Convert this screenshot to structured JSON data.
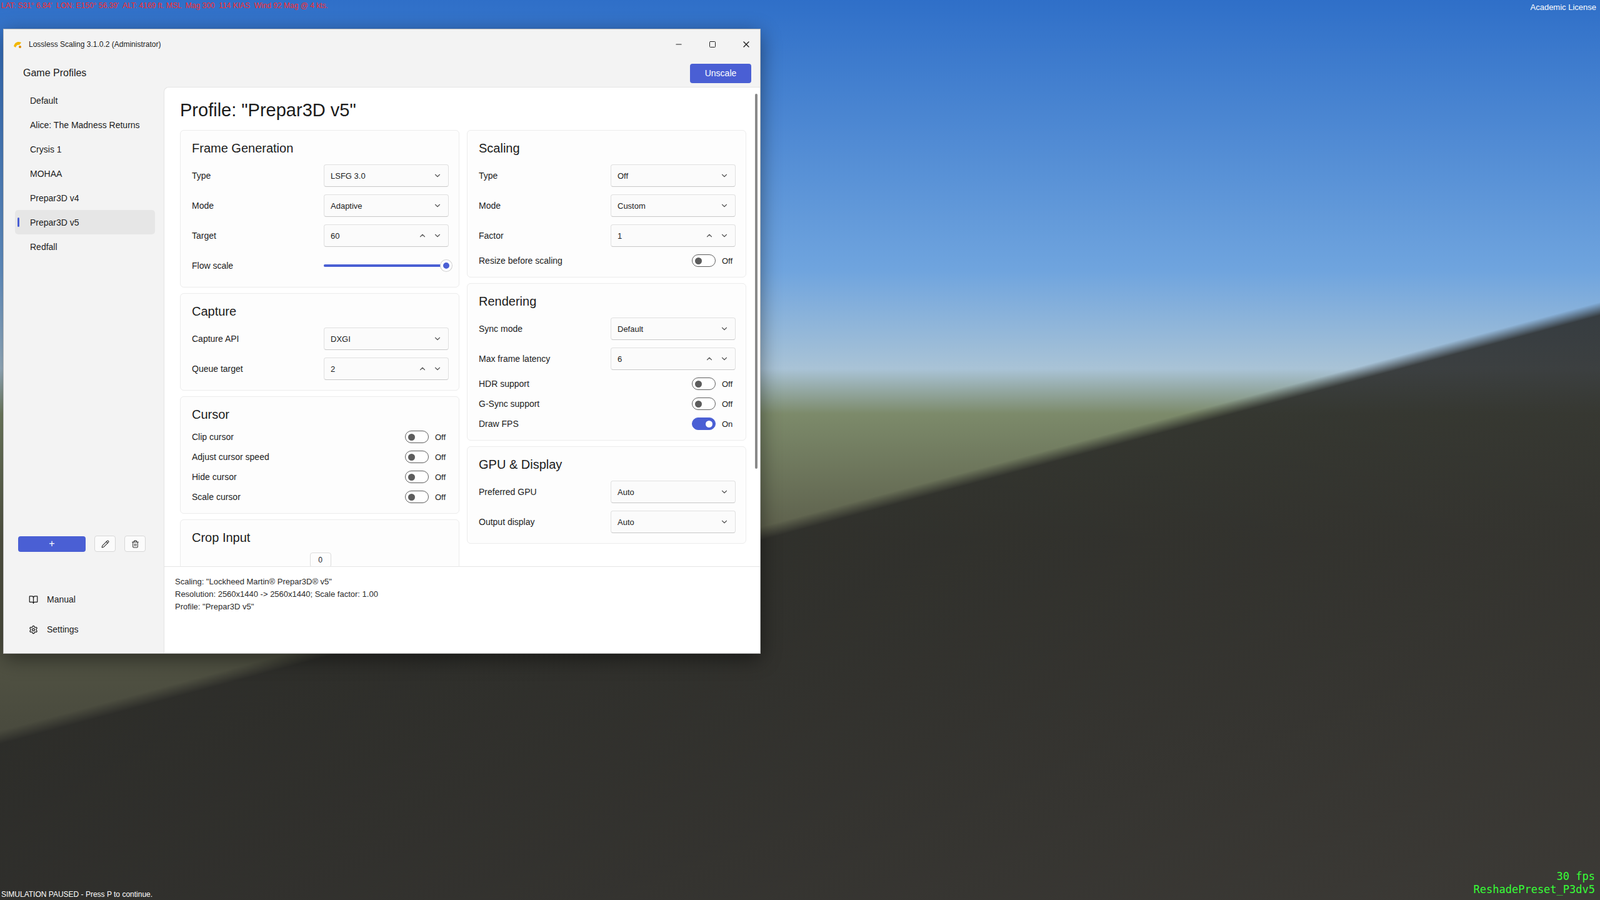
{
  "game": {
    "hud": "LAT: S31° 6.84'  LON: E150° 56.39'  ALT: 4169 ft. MSL  Mag 300  114 KIAS  Wind 92 Mag @ 4 kts.",
    "license": "Academic License",
    "paused": "SIMULATION PAUSED - Press P to continue.",
    "fps": "30 fps",
    "preset": "ReshadePreset_P3dv5"
  },
  "window": {
    "title": "Lossless Scaling 3.1.0.2 (Administrator)"
  },
  "sidebar": {
    "heading": "Game Profiles",
    "items": [
      {
        "label": "Default",
        "selected": false
      },
      {
        "label": "Alice: The Madness Returns",
        "selected": false
      },
      {
        "label": "Crysis 1",
        "selected": false
      },
      {
        "label": "MOHAA",
        "selected": false
      },
      {
        "label": "Prepar3D v4",
        "selected": false
      },
      {
        "label": "Prepar3D v5",
        "selected": true
      },
      {
        "label": "Redfall",
        "selected": false
      }
    ],
    "add_button": "+",
    "footer": [
      "Manual",
      "Settings"
    ]
  },
  "toolbar": {
    "unscale": "Unscale"
  },
  "profile": {
    "title": "Profile: \"Prepar3D v5\""
  },
  "columns": [
    [
      {
        "title": "Frame Generation",
        "rows": [
          {
            "kind": "dropdown",
            "label": "Type",
            "value": "LSFG 3.0"
          },
          {
            "kind": "dropdown",
            "label": "Mode",
            "value": "Adaptive"
          },
          {
            "kind": "stepper",
            "label": "Target",
            "value": "60"
          },
          {
            "kind": "slider",
            "label": "Flow scale",
            "level": 1
          }
        ]
      },
      {
        "title": "Capture",
        "rows": [
          {
            "kind": "dropdown",
            "label": "Capture API",
            "value": "DXGI"
          },
          {
            "kind": "stepper",
            "label": "Queue target",
            "value": "2"
          }
        ]
      },
      {
        "title": "Cursor",
        "rows": [
          {
            "kind": "toggle",
            "label": "Clip cursor",
            "on": false,
            "state": "Off"
          },
          {
            "kind": "toggle",
            "label": "Adjust cursor speed",
            "on": false,
            "state": "Off"
          },
          {
            "kind": "toggle",
            "label": "Hide cursor",
            "on": false,
            "state": "Off"
          },
          {
            "kind": "toggle",
            "label": "Scale cursor",
            "on": false,
            "state": "Off"
          }
        ]
      },
      {
        "title": "Crop Input",
        "rows": [
          {
            "kind": "field",
            "value": "0"
          }
        ]
      }
    ],
    [
      {
        "title": "Scaling",
        "rows": [
          {
            "kind": "dropdown",
            "label": "Type",
            "value": "Off"
          },
          {
            "kind": "dropdown",
            "label": "Mode",
            "value": "Custom"
          },
          {
            "kind": "stepper",
            "label": "Factor",
            "value": "1"
          },
          {
            "kind": "toggle",
            "label": "Resize before scaling",
            "on": false,
            "state": "Off"
          }
        ]
      },
      {
        "title": "Rendering",
        "rows": [
          {
            "kind": "dropdown",
            "label": "Sync mode",
            "value": "Default"
          },
          {
            "kind": "stepper",
            "label": "Max frame latency",
            "value": "6"
          },
          {
            "kind": "toggle",
            "label": "HDR support",
            "on": false,
            "state": "Off"
          },
          {
            "kind": "toggle",
            "label": "G-Sync support",
            "on": false,
            "state": "Off"
          },
          {
            "kind": "toggle",
            "label": "Draw FPS",
            "on": true,
            "state": "On"
          }
        ]
      },
      {
        "title": "GPU & Display",
        "rows": [
          {
            "kind": "dropdown",
            "label": "Preferred GPU",
            "value": "Auto"
          },
          {
            "kind": "dropdown",
            "label": "Output display",
            "value": "Auto"
          }
        ]
      }
    ]
  ],
  "status": [
    "Scaling: \"Lockheed Martin® Prepar3D® v5\"",
    "Resolution: 2560x1440 -> 2560x1440; Scale factor: 1.00",
    "Profile: \"Prepar3D v5\""
  ]
}
